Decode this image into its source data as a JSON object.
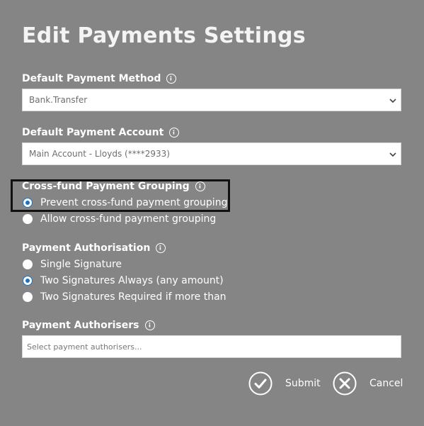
{
  "title": "Edit Payments Settings",
  "payment_method": {
    "label": "Default Payment Method",
    "value": "Bank.Transfer"
  },
  "payment_account": {
    "label": "Default Payment Account",
    "value": "Main Account - Lloyds (****2933)"
  },
  "cross_fund": {
    "label": "Cross-fund Payment Grouping",
    "options": [
      {
        "label": "Prevent cross-fund payment grouping",
        "checked": true
      },
      {
        "label": "Allow cross-fund payment grouping",
        "checked": false
      }
    ]
  },
  "authorisation": {
    "label": "Payment Authorisation",
    "options": [
      {
        "label": "Single Signature",
        "checked": false
      },
      {
        "label": "Two Signatures Always (any amount)",
        "checked": true
      },
      {
        "label": "Two Signatures Required if more than",
        "checked": false
      }
    ]
  },
  "authorisers": {
    "label": "Payment Authorisers",
    "placeholder": "Select payment authorisers..."
  },
  "actions": {
    "submit": "Submit",
    "cancel": "Cancel"
  },
  "colors": {
    "background": "#858585",
    "radio_accent": "#1a73c8"
  }
}
